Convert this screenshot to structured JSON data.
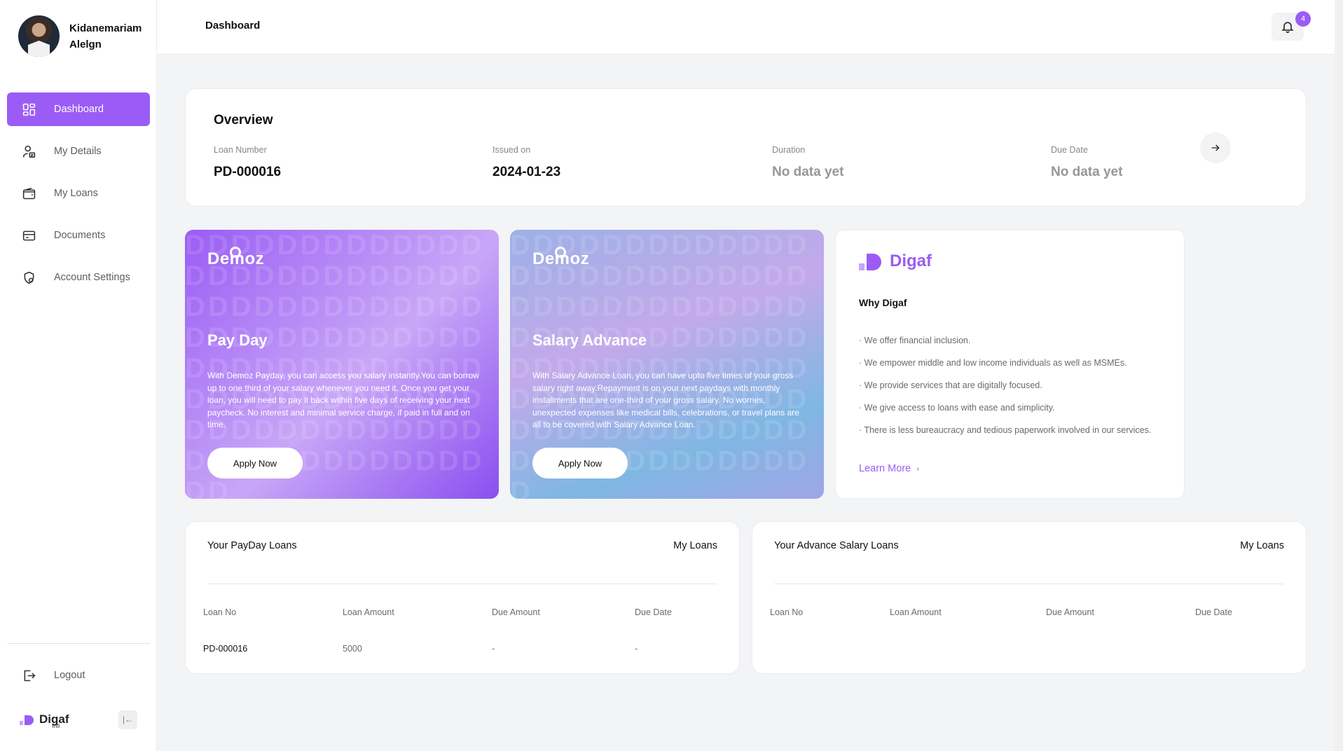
{
  "user": {
    "name_line1": "Kidanemariam",
    "name_line2": "Alelgn"
  },
  "sidebar": {
    "items": [
      {
        "label": "Dashboard",
        "icon": "dashboard-icon",
        "active": true
      },
      {
        "label": "My Details",
        "icon": "user-details-icon"
      },
      {
        "label": "My Loans",
        "icon": "wallet-icon"
      },
      {
        "label": "Documents",
        "icon": "card-icon"
      },
      {
        "label": "Account Settings",
        "icon": "settings-shield-icon"
      }
    ],
    "logout": "Logout",
    "brand": "Digaf",
    "brand_sub": "mfi"
  },
  "header": {
    "title": "Dashboard",
    "notifications": "4"
  },
  "overview": {
    "title": "Overview",
    "fields": [
      {
        "label": "Loan Number",
        "value": "PD-000016"
      },
      {
        "label": "Issued on",
        "value": "2024-01-23"
      },
      {
        "label": "Duration",
        "value": "No data yet"
      },
      {
        "label": "Due Date",
        "value": "No data yet"
      }
    ]
  },
  "promos": {
    "payday": {
      "brand": "Demoz",
      "title": "Pay Day",
      "text": "With Demoz Payday, you can access you salary instantly.You can borrow up to one third of your salary whenever you need it. Once you get your loan, you will need to pay it back within five days of receiving your next paycheck. No interest and minimal service charge, if paid in full and on time.",
      "button": "Apply Now"
    },
    "salary": {
      "brand": "Demoz",
      "title": "Salary Advance",
      "text": "With Salary Advance Loan, you can have upto five times of your gross salary right away.Repayment is on your next paydays with monthly installments that are one-third of your gross salary. No worries, unexpected expenses like medical bills, celebrations, or travel plans are all to be covered with Salary Advance Loan.",
      "button": "Apply Now"
    }
  },
  "why": {
    "brand": "Digaf",
    "title": "Why Digaf",
    "points": [
      "We offer financial inclusion.",
      "We empower middle and low income individuals as well as MSMEs.",
      "We provide services that are digitally focused.",
      "We give access to loans with ease and simplicity.",
      "There is less bureaucracy and tedious paperwork involved in our services."
    ],
    "link": "Learn More"
  },
  "payday_loans": {
    "title": "Your PayDay Loans",
    "link": "My Loans",
    "columns": [
      "Loan No",
      "Loan Amount",
      "Due Amount",
      "Due Date"
    ],
    "rows": [
      [
        "PD-000016",
        "5000",
        "-",
        "-"
      ]
    ]
  },
  "salary_loans": {
    "title": "Your Advance Salary Loans",
    "link": "My Loans",
    "columns": [
      "Loan No",
      "Loan Amount",
      "Due Amount",
      "Due Date"
    ],
    "rows": []
  },
  "colors": {
    "accent": "#9b5cf5",
    "background": "#f3f4f6"
  }
}
